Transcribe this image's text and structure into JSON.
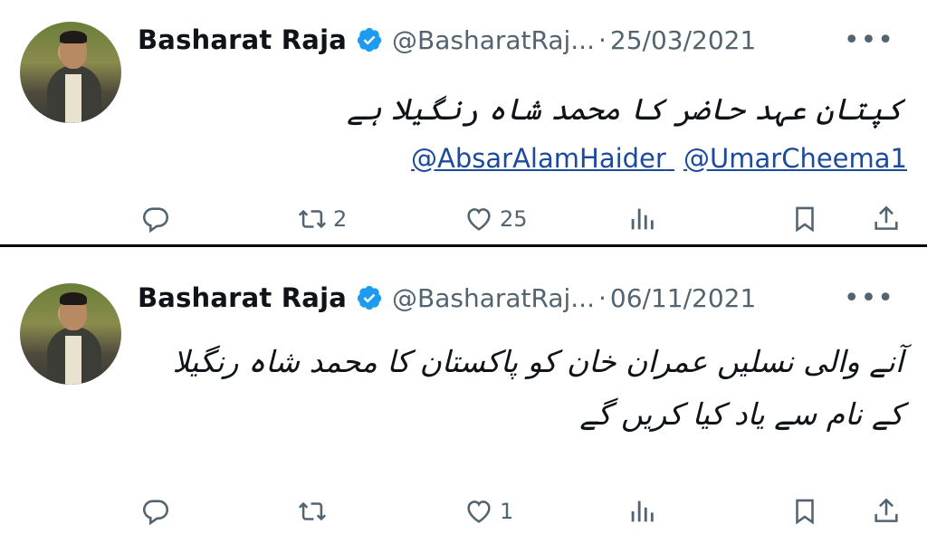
{
  "tweets": [
    {
      "name": "Basharat Raja",
      "handle": "@BasharatRaj...",
      "separator": "·",
      "date": "25/03/2021",
      "more": "•••",
      "text": "کپتان عہد حاضر کا محمد شاہ رنگیلا ہے",
      "mentions": [
        "@AbsarAlamHaider",
        "@UmarCheema1"
      ],
      "actions": {
        "reply": "",
        "retweet": "2",
        "like": "25",
        "views": ""
      }
    },
    {
      "name": "Basharat Raja",
      "handle": "@BasharatRaj...",
      "separator": "·",
      "date": "06/11/2021",
      "more": "•••",
      "text": "آنے والی نسلیں عمران خان کو پاکستان کا محمد شاہ رنگیلا کے نام سے یاد کیا کریں گے",
      "mentions": [],
      "actions": {
        "reply": "",
        "retweet": "",
        "like": "1",
        "views": ""
      }
    }
  ],
  "icons": {
    "verified_color": "#1d9bf0",
    "reply": "reply-icon",
    "retweet": "retweet-icon",
    "like": "like-icon",
    "views": "views-icon",
    "bookmark": "bookmark-icon",
    "share": "share-icon"
  }
}
